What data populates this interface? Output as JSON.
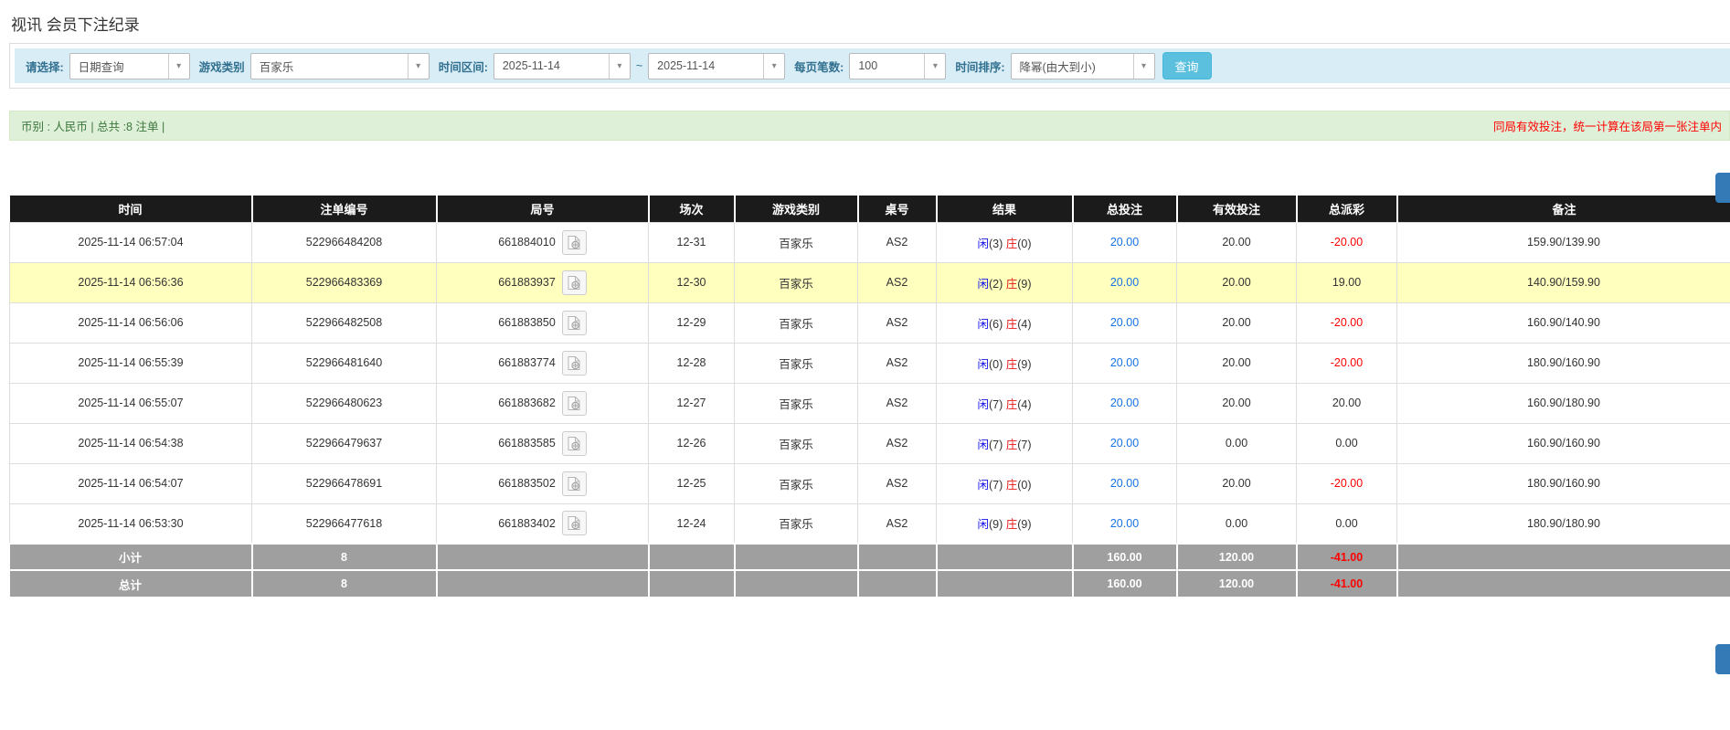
{
  "page": {
    "title": "视讯 会员下注纪录"
  },
  "icons": {
    "dropdown_arrow": "▾"
  },
  "colors": {
    "filter_bar_bg": "#d9edf7",
    "search_button": "#5bc0de",
    "pager_button": "#337ab7",
    "summary_bar_bg": "#dff0d8",
    "summary_text_green": "#3c763d",
    "note_red": "#ff0000",
    "table_header_bg": "#1b1b1b",
    "highlight_row": "#ffffbe",
    "totals_row_bg": "#9f9f9f",
    "player_blue": "#1414e8",
    "banker_red": "#e81414",
    "bet_amount_link": "#1673e6"
  },
  "filters": {
    "select_label": "请选择:",
    "select_value": "日期查询",
    "game_type_label": "游戏类别",
    "game_type_value": "百家乐",
    "time_range_label": "时间区间:",
    "date_from": "2025-11-14",
    "tilde": "~",
    "date_to": "2025-11-14",
    "page_size_label": "每页笔数:",
    "page_size_value": "100",
    "sort_label": "时间排序:",
    "sort_value": "降幂(由大到小)",
    "search_button": "查询"
  },
  "summary": {
    "left": "币别 : 人民币 | 总共 :8 注单 |",
    "right_note": "同局有效投注，统一计算在该局第一张注单内"
  },
  "table": {
    "headers": [
      "时间",
      "注单编号",
      "局号",
      "场次",
      "游戏类别",
      "桌号",
      "结果",
      "总投注",
      "有效投注",
      "总派彩",
      "备注"
    ],
    "rows": [
      {
        "time": "2025-11-14 06:57:04",
        "bet_id": "522966484208",
        "round_id": "661884010",
        "session": "12-31",
        "game": "百家乐",
        "table_no": "AS2",
        "result": {
          "player_label": "闲",
          "player_score": "(3)",
          "banker_label": "庄",
          "banker_score": "(0)"
        },
        "total_bet": "20.00",
        "valid_bet": "20.00",
        "payout": "-20.00",
        "remark": "159.90/139.90",
        "highlight": false
      },
      {
        "time": "2025-11-14 06:56:36",
        "bet_id": "522966483369",
        "round_id": "661883937",
        "session": "12-30",
        "game": "百家乐",
        "table_no": "AS2",
        "result": {
          "player_label": "闲",
          "player_score": "(2)",
          "banker_label": "庄",
          "banker_score": "(9)"
        },
        "total_bet": "20.00",
        "valid_bet": "20.00",
        "payout": "19.00",
        "remark": "140.90/159.90",
        "highlight": true
      },
      {
        "time": "2025-11-14 06:56:06",
        "bet_id": "522966482508",
        "round_id": "661883850",
        "session": "12-29",
        "game": "百家乐",
        "table_no": "AS2",
        "result": {
          "player_label": "闲",
          "player_score": "(6)",
          "banker_label": "庄",
          "banker_score": "(4)"
        },
        "total_bet": "20.00",
        "valid_bet": "20.00",
        "payout": "-20.00",
        "remark": "160.90/140.90",
        "highlight": false
      },
      {
        "time": "2025-11-14 06:55:39",
        "bet_id": "522966481640",
        "round_id": "661883774",
        "session": "12-28",
        "game": "百家乐",
        "table_no": "AS2",
        "result": {
          "player_label": "闲",
          "player_score": "(0)",
          "banker_label": "庄",
          "banker_score": "(9)"
        },
        "total_bet": "20.00",
        "valid_bet": "20.00",
        "payout": "-20.00",
        "remark": "180.90/160.90",
        "highlight": false
      },
      {
        "time": "2025-11-14 06:55:07",
        "bet_id": "522966480623",
        "round_id": "661883682",
        "session": "12-27",
        "game": "百家乐",
        "table_no": "AS2",
        "result": {
          "player_label": "闲",
          "player_score": "(7)",
          "banker_label": "庄",
          "banker_score": "(4)"
        },
        "total_bet": "20.00",
        "valid_bet": "20.00",
        "payout": "20.00",
        "remark": "160.90/180.90",
        "highlight": false
      },
      {
        "time": "2025-11-14 06:54:38",
        "bet_id": "522966479637",
        "round_id": "661883585",
        "session": "12-26",
        "game": "百家乐",
        "table_no": "AS2",
        "result": {
          "player_label": "闲",
          "player_score": "(7)",
          "banker_label": "庄",
          "banker_score": "(7)"
        },
        "total_bet": "20.00",
        "valid_bet": "0.00",
        "payout": "0.00",
        "remark": "160.90/160.90",
        "highlight": false
      },
      {
        "time": "2025-11-14 06:54:07",
        "bet_id": "522966478691",
        "round_id": "661883502",
        "session": "12-25",
        "game": "百家乐",
        "table_no": "AS2",
        "result": {
          "player_label": "闲",
          "player_score": "(7)",
          "banker_label": "庄",
          "banker_score": "(0)"
        },
        "total_bet": "20.00",
        "valid_bet": "20.00",
        "payout": "-20.00",
        "remark": "180.90/160.90",
        "highlight": false
      },
      {
        "time": "2025-11-14 06:53:30",
        "bet_id": "522966477618",
        "round_id": "661883402",
        "session": "12-24",
        "game": "百家乐",
        "table_no": "AS2",
        "result": {
          "player_label": "闲",
          "player_score": "(9)",
          "banker_label": "庄",
          "banker_score": "(9)"
        },
        "total_bet": "20.00",
        "valid_bet": "0.00",
        "payout": "0.00",
        "remark": "180.90/180.90",
        "highlight": false
      }
    ],
    "subtotal": {
      "label": "小计",
      "count": "8",
      "total_bet": "160.00",
      "valid_bet": "120.00",
      "payout": "-41.00"
    },
    "total": {
      "label": "总计",
      "count": "8",
      "total_bet": "160.00",
      "valid_bet": "120.00",
      "payout": "-41.00"
    }
  }
}
